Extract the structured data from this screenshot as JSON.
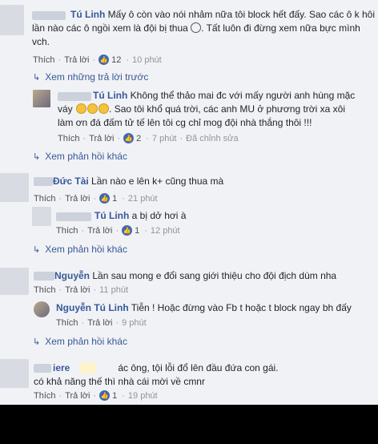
{
  "actions": {
    "like": "Thích",
    "reply": "Trả lời",
    "dot": "·"
  },
  "c1": {
    "name": "Tú Linh",
    "line1": "Mấy ô còn vào nói nhảm nữa tôi block hết đấy. Sao các ô k hôi",
    "line2a": "lần nào các ô ngồi xem là đội bị thua",
    "line2b": ". Tất luôn đi đừng xem nữa bực mình",
    "line3": "vch.",
    "likes": "12",
    "time": "10 phút"
  },
  "view_prev": {
    "label": "Xem những trả lời trước"
  },
  "r1": {
    "name": "Tú Linh",
    "line1": "Không thể thảo mai đc với mấy người anh hùng mặc",
    "line2a": "váy",
    "line2b": ". Sao tôi khổ quá trời, các anh MU ở phương trời xa xôi",
    "line3": "làm ơn đá đấm tử tế lên tôi cg chỉ mog đội nhà thắng thôi !!!",
    "likes": "2",
    "time": "7 phút",
    "edited": "Đã chỉnh sửa"
  },
  "more1": {
    "label": "Xem phản hồi khác"
  },
  "c2": {
    "name": "Đức Tài",
    "text": "Lần nào e lên k+ cũng thua mà",
    "likes": "1",
    "time": "21 phút"
  },
  "r2": {
    "name": "Tú Linh",
    "text": "a bị dở hơi à",
    "likes": "1",
    "time": "12 phút"
  },
  "more2": {
    "label": "Xem phản hồi khác"
  },
  "c3": {
    "name": "Nguyễn",
    "text": "Lần sau mong e đổi sang giới thiệu cho đội địch dùm nha",
    "time": "11 phút"
  },
  "r3": {
    "name": "Nguyễn Tú Linh",
    "text": "Tiễn ! Hoặc đừng vào Fb t hoặc t block ngay bh đấy",
    "time": "9 phút"
  },
  "more3": {
    "label": "Xem phản hồi khác"
  },
  "c4": {
    "name": "iere",
    "line1": "ác ông, tội lỗi đổ lên đầu đứa con gái.",
    "line2": "có khả năng thế thì nhà cái mời về cmnr",
    "likes": "1",
    "time": "19 phút"
  },
  "colors": {
    "link": "#365899",
    "like_blue": "#4267b2",
    "meta_gray": "#90949c"
  }
}
